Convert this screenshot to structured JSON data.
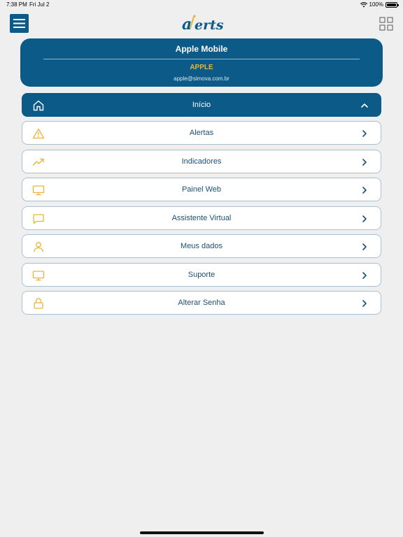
{
  "status_bar": {
    "time": "7:38 PM",
    "date": "Fri Jul 2",
    "battery": "100%"
  },
  "header": {
    "logo_text": "alerts"
  },
  "profile": {
    "name": "Apple Mobile",
    "company": "APPLE",
    "email": "apple@simova.com.br"
  },
  "menu": [
    {
      "label": "Início",
      "icon": "home-icon",
      "active": true
    },
    {
      "label": "Alertas",
      "icon": "warning-icon",
      "active": false
    },
    {
      "label": "Indicadores",
      "icon": "trending-up-icon",
      "active": false
    },
    {
      "label": "Painel Web",
      "icon": "monitor-icon",
      "active": false
    },
    {
      "label": "Assistente Virtual",
      "icon": "chat-icon",
      "active": false
    },
    {
      "label": "Meus dados",
      "icon": "user-icon",
      "active": false
    },
    {
      "label": "Suporte",
      "icon": "monitor-icon",
      "active": false
    },
    {
      "label": "Alterar Senha",
      "icon": "lock-icon",
      "active": false
    }
  ],
  "colors": {
    "primary": "#0c5a87",
    "accent": "#e8b33a",
    "background": "#efefef"
  }
}
